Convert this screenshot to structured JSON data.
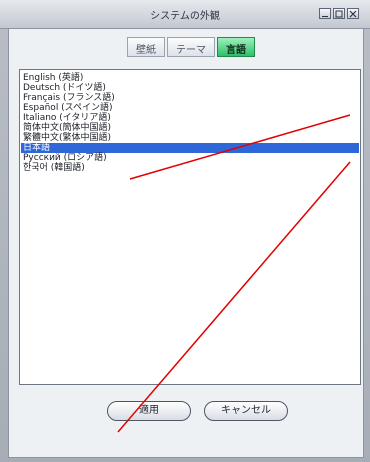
{
  "window": {
    "title": "システムの外観"
  },
  "tabs": [
    {
      "label": "壁紙"
    },
    {
      "label": "テーマ"
    },
    {
      "label": "言語"
    }
  ],
  "languages": [
    "English (英語)",
    "Deutsch (ドイツ語)",
    "Français (フランス語)",
    "Español (スペイン語)",
    "Italiano (イタリア語)",
    "简体中文(簡体中国語)",
    "繁體中文(繁体中国語)",
    "日本語",
    "Русский (ロシア語)",
    "한국어 (韓国語)"
  ],
  "selected_language": "日本語",
  "buttons": {
    "apply": "適用",
    "cancel": "キャンセル"
  },
  "icons": {
    "minimize": "minimize-icon",
    "maximize": "maximize-icon",
    "close": "close-icon"
  },
  "colors": {
    "active_tab": "#2dbf68",
    "selection": "#2f66d8",
    "annotation": "#e10000"
  }
}
